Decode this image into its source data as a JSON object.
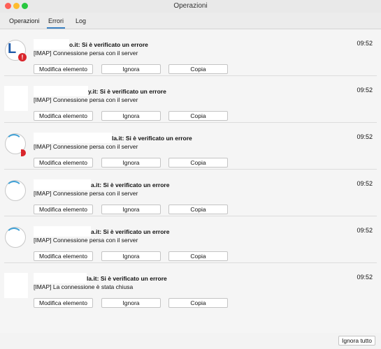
{
  "window": {
    "title": "Operazioni"
  },
  "tabs": [
    {
      "label": "Operazioni"
    },
    {
      "label": "Errori"
    },
    {
      "label": "Log"
    }
  ],
  "items": [
    {
      "heading": "o.it: Si è verificato un errore",
      "message": "[IMAP] Connessione persa con il server",
      "time": "09:52"
    },
    {
      "heading": "y.it: Si è verificato un errore",
      "message": "[IMAP] Connessione persa con il server",
      "time": "09:52"
    },
    {
      "heading": "la.it: Si è verificato un errore",
      "message": "[IMAP] Connessione persa con il server",
      "time": "09:52"
    },
    {
      "heading": "a.it: Si è verificato un errore",
      "message": "[IMAP] Connessione persa con il server",
      "time": "09:52"
    },
    {
      "heading": "a.it: Si è verificato un errore",
      "message": "[IMAP] Connessione persa con il server",
      "time": "09:52"
    },
    {
      "heading": "la.it: Si è verificato un errore",
      "message": "[IMAP] La connessione è stata chiusa",
      "time": "09:52"
    }
  ],
  "buttons": {
    "edit": "Modifica elemento",
    "ignore": "Ignora",
    "copy": "Copia",
    "ignore_all": "Ignora tutto"
  },
  "icons": {
    "close": "close-window-icon",
    "minimize": "minimize-window-icon",
    "maximize": "maximize-window-icon",
    "error_badge": "warning-icon",
    "badge_glyph": "!"
  },
  "colors": {
    "accent": "#3b82c4",
    "error": "#d9262c",
    "logo": "#1e5aa8"
  }
}
